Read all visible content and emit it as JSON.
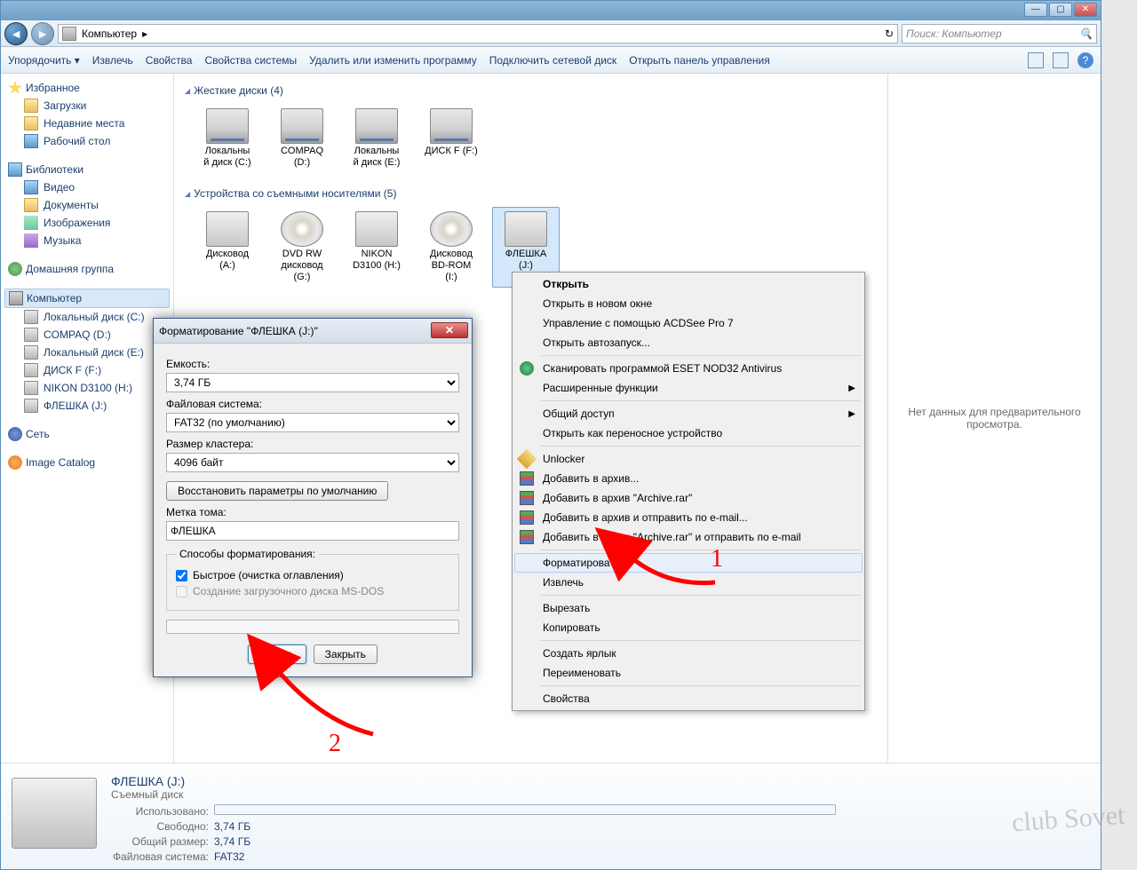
{
  "titlebar": {
    "min": "—",
    "max": "▢",
    "close": "✕"
  },
  "nav": {
    "path_label": "Компьютер",
    "path_arrow": "▸",
    "refresh": "↻",
    "search_placeholder": "Поиск: Компьютер",
    "search_icon": "🔍"
  },
  "toolbar": {
    "organize": "Упорядочить ▾",
    "extract": "Извлечь",
    "properties": "Свойства",
    "sysprops": "Свойства системы",
    "uninstall": "Удалить или изменить программу",
    "mapdrive": "Подключить сетевой диск",
    "cpanel": "Открыть панель управления",
    "help": "?"
  },
  "sidebar": {
    "fav_header": "Избранное",
    "fav": [
      "Загрузки",
      "Недавние места",
      "Рабочий стол"
    ],
    "lib_header": "Библиотеки",
    "lib": [
      "Видео",
      "Документы",
      "Изображения",
      "Музыка"
    ],
    "homegroup": "Домашняя группа",
    "computer": "Компьютер",
    "drives": [
      "Локальный диск (C:)",
      "COMPAQ (D:)",
      "Локальный диск (E:)",
      "ДИСК F (F:)",
      "NIKON D3100 (H:)",
      "ФЛЕШКА (J:)"
    ],
    "network": "Сеть",
    "catalog": "Image Catalog"
  },
  "content": {
    "sec1": "Жесткие диски (4)",
    "hd": [
      {
        "l1": "Локальны",
        "l2": "й диск (C:)"
      },
      {
        "l1": "COMPAQ",
        "l2": "(D:)"
      },
      {
        "l1": "Локальны",
        "l2": "й диск (E:)"
      },
      {
        "l1": "ДИСК F (F:)",
        "l2": ""
      }
    ],
    "sec2": "Устройства со съемными носителями (5)",
    "rm": [
      {
        "l1": "Дисковод",
        "l2": "(A:)",
        "cls": "usb"
      },
      {
        "l1": "DVD RW",
        "l2": "дисковод",
        "l3": "(G:)",
        "cls": "cd"
      },
      {
        "l1": "NIKON",
        "l2": "D3100 (H:)",
        "cls": "usb"
      },
      {
        "l1": "Дисковод",
        "l2": "BD-ROM",
        "l3": "(I:)",
        "cls": "cd"
      },
      {
        "l1": "ФЛЕШКА",
        "l2": "(J:)",
        "cls": "usb",
        "sel": true
      }
    ]
  },
  "preview": "Нет данных для предварительного просмотра.",
  "details": {
    "title": "ФЛЕШКА (J:)",
    "subtitle": "Съемный диск",
    "rows": [
      {
        "k": "Использовано:",
        "v": "",
        "bar": true
      },
      {
        "k": "Свободно:",
        "v": "3,74 ГБ"
      },
      {
        "k": "Общий размер:",
        "v": "3,74 ГБ"
      },
      {
        "k": "Файловая система:",
        "v": "FAT32"
      }
    ]
  },
  "ctx": {
    "items": [
      {
        "t": "Открыть",
        "b": true
      },
      {
        "t": "Открыть в новом окне"
      },
      {
        "t": "Управление с помощью ACDSee Pro 7"
      },
      {
        "t": "Открыть автозапуск..."
      },
      {
        "sep": true
      },
      {
        "t": "Сканировать программой ESET NOD32 Antivirus",
        "ic": "mic-av"
      },
      {
        "t": "Расширенные функции",
        "sub": true
      },
      {
        "sep": true
      },
      {
        "t": "Общий доступ",
        "sub": true
      },
      {
        "t": "Открыть как переносное устройство"
      },
      {
        "sep": true
      },
      {
        "t": "Unlocker",
        "ic": "mic-key"
      },
      {
        "t": "Добавить в архив...",
        "ic": "mic-rar"
      },
      {
        "t": "Добавить в архив \"Archive.rar\"",
        "ic": "mic-rar"
      },
      {
        "t": "Добавить в архив и отправить по e-mail...",
        "ic": "mic-rar"
      },
      {
        "t": "Добавить в архив \"Archive.rar\" и отправить по e-mail",
        "ic": "mic-rar"
      },
      {
        "sep": true
      },
      {
        "t": "Форматировать...",
        "hl": true
      },
      {
        "t": "Извлечь"
      },
      {
        "sep": true
      },
      {
        "t": "Вырезать"
      },
      {
        "t": "Копировать"
      },
      {
        "sep": true
      },
      {
        "t": "Создать ярлык"
      },
      {
        "t": "Переименовать"
      },
      {
        "sep": true
      },
      {
        "t": "Свойства"
      }
    ]
  },
  "dlg": {
    "title": "Форматирование \"ФЛЕШКА (J:)\"",
    "capacity_label": "Емкость:",
    "capacity": "3,74 ГБ",
    "fs_label": "Файловая система:",
    "fs": "FAT32 (по умолчанию)",
    "cluster_label": "Размер кластера:",
    "cluster": "4096 байт",
    "restore": "Восстановить параметры по умолчанию",
    "volume_label": "Метка тома:",
    "volume": "ФЛЕШКА",
    "group": "Способы форматирования:",
    "quick": "Быстрое (очистка оглавления)",
    "msdos": "Создание загрузочного диска MS-DOS",
    "start": "Начать",
    "close": "Закрыть"
  },
  "annot": {
    "n1": "1",
    "n2": "2"
  },
  "watermark": "club Sovet"
}
